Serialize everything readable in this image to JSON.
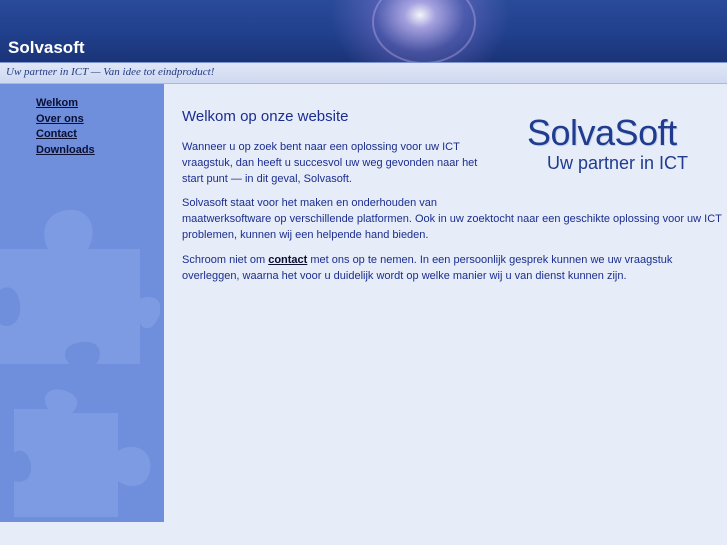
{
  "header": {
    "site_title": "Solvasoft",
    "tagline": "Uw partner in ICT — Van idee tot eindproduct!"
  },
  "nav": {
    "items": [
      {
        "label": "Welkom"
      },
      {
        "label": "Over ons"
      },
      {
        "label": "Contact"
      },
      {
        "label": "Downloads"
      }
    ]
  },
  "main": {
    "heading": "Welkom op onze website",
    "p1_line1": "Wanneer u op zoek bent naar een oplossing voor uw ICT",
    "p1_line2": "vraagstuk, dan heeft u succesvol uw weg gevonden naar het",
    "p1_line3": "start punt — in dit geval, Solvasoft.",
    "p2_line1": "Solvasoft staat voor het maken en onderhouden van",
    "p2_line2": "maatwerksoftware op verschillende platformen. Ook in uw zoektocht naar een geschikte oplossing voor uw ICT",
    "p2_line3": "problemen, kunnen wij een helpende hand bieden.",
    "p3_before": "Schroom niet om ",
    "p3_link": "contact",
    "p3_after": " met ons op te nemen. In een persoonlijk gesprek kunnen we uw vraagstuk",
    "p3_line2": "overleggen, waarna het voor u duidelijk wordt op welke manier wij u van dienst kunnen zijn."
  },
  "logo": {
    "name": "SolvaSoft",
    "subtitle": "Uw partner in ICT"
  },
  "icons": {
    "puzzle": "puzzle-piece-icon"
  },
  "colors": {
    "header": "#203f8c",
    "sidebar": "#6f8fdc",
    "page_bg": "#e6ecf8",
    "text": "#1b2e8f"
  }
}
